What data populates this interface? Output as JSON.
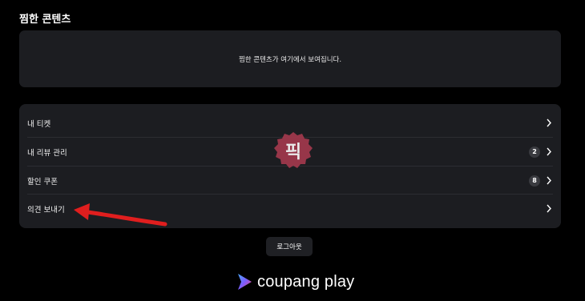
{
  "favorites": {
    "title": "찜한 콘텐츠",
    "empty_message": "찜한 콘텐츠가 여기에서 보여집니다."
  },
  "menu": {
    "items": [
      {
        "label": "내 티켓",
        "badge": null
      },
      {
        "label": "내 리뷰 관리",
        "badge": "2"
      },
      {
        "label": "할인 쿠폰",
        "badge": "8"
      },
      {
        "label": "의견 보내기",
        "badge": null
      }
    ]
  },
  "logout_label": "로그아웃",
  "brand": {
    "name": "coupang play"
  },
  "watermark": {
    "text": "픽"
  },
  "colors": {
    "background": "#000000",
    "panel": "#1c1d21",
    "badge": "#3a3b40",
    "annotation_arrow": "#e01e1e",
    "stamp": "#a83a4f"
  }
}
